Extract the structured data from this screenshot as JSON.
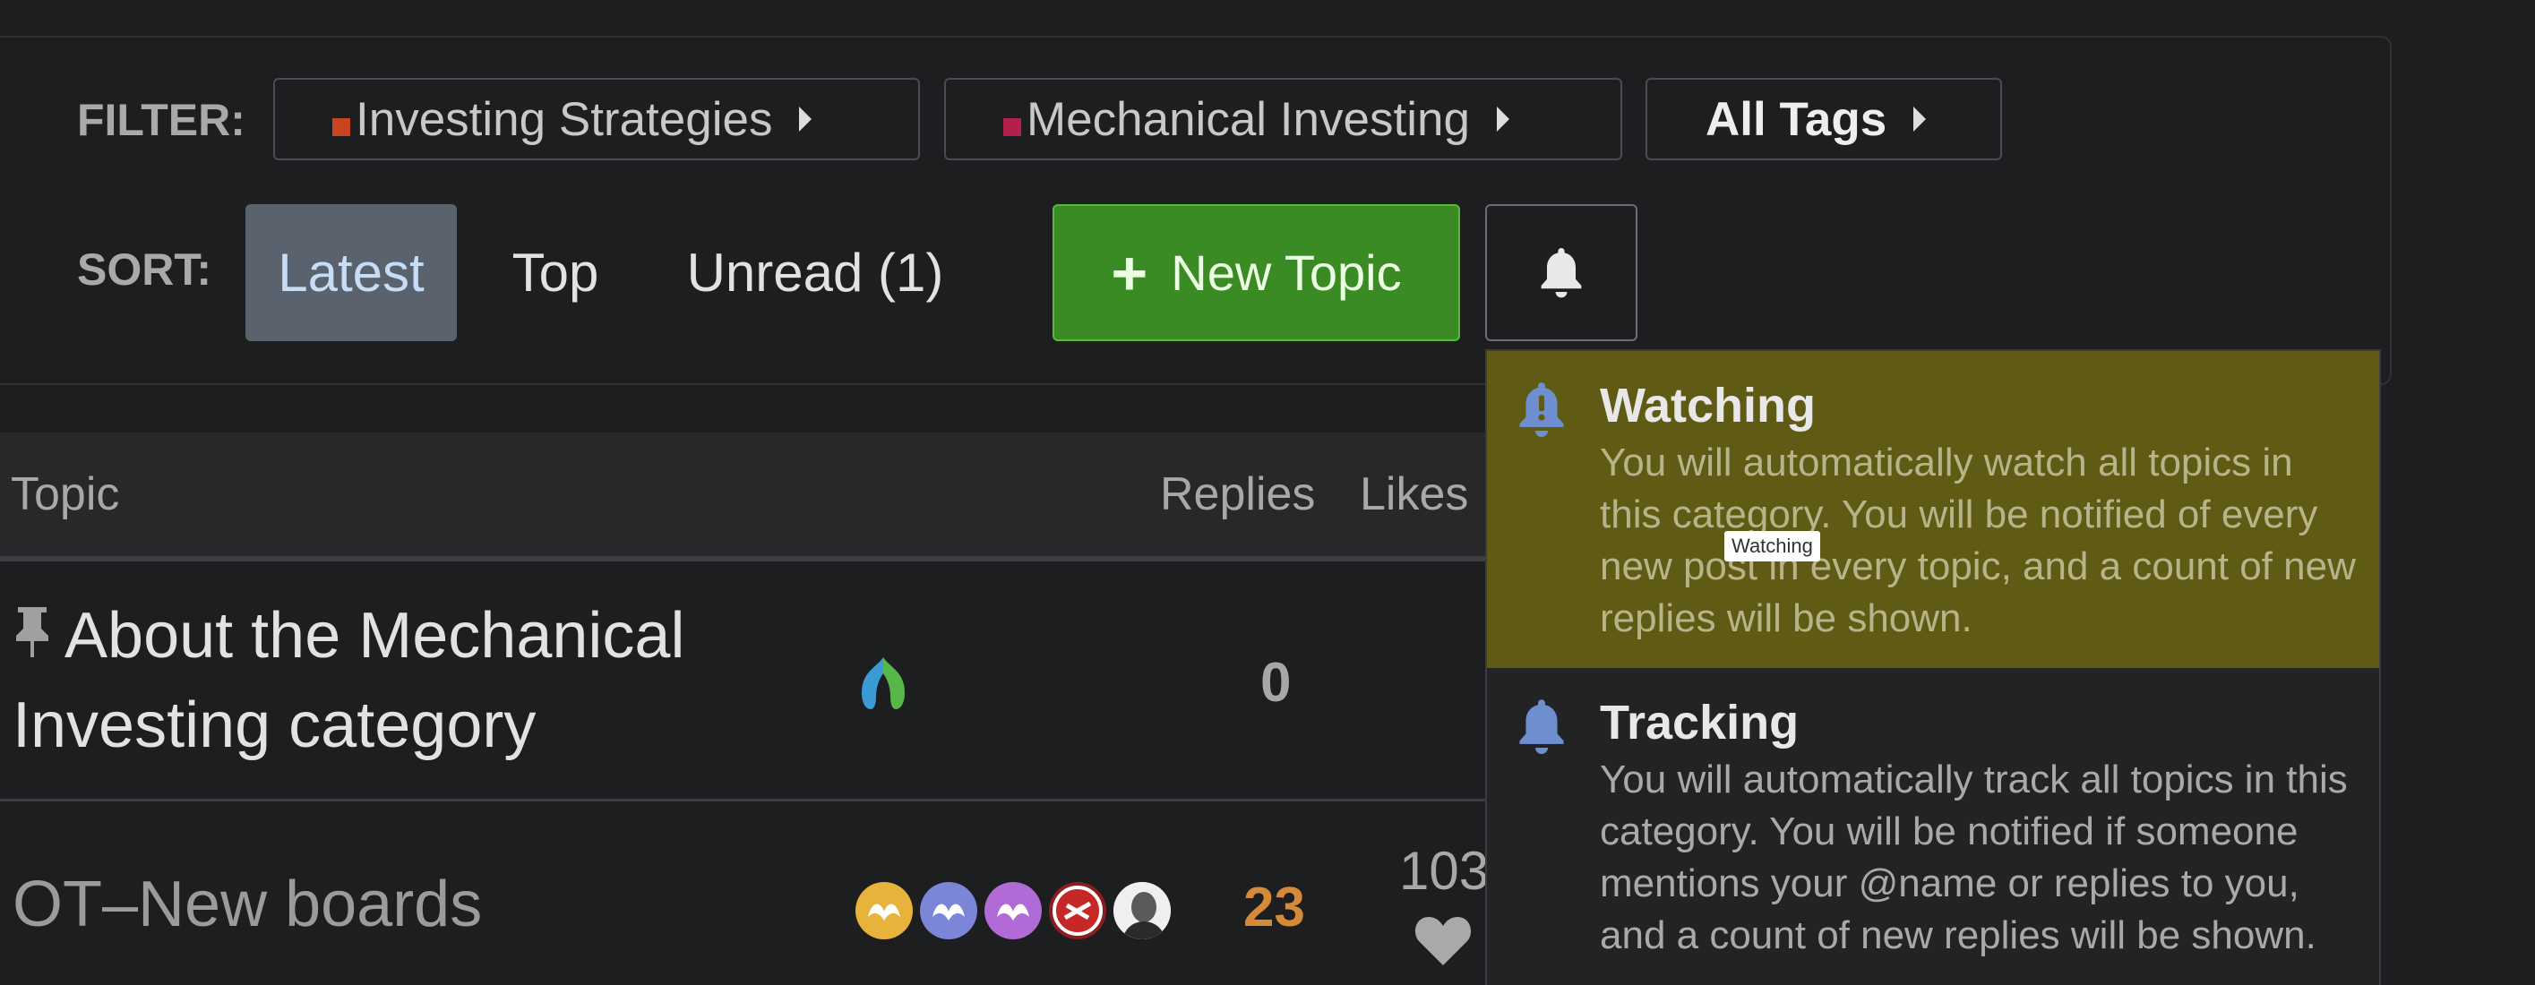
{
  "filter": {
    "label": "FILTER:",
    "categories": [
      {
        "label": "Investing Strategies",
        "color": "#c9451f"
      },
      {
        "label": "Mechanical Investing",
        "color": "#b3204b"
      }
    ],
    "tags_label": "All Tags"
  },
  "sort": {
    "label": "SORT:",
    "items": [
      "Latest",
      "Top",
      "Unread (1)"
    ],
    "active": "Latest"
  },
  "actions": {
    "new_topic_label": "New Topic",
    "notifications_icon": "bell-icon"
  },
  "table": {
    "headers": {
      "topic": "Topic",
      "replies": "Replies",
      "likes": "Likes"
    },
    "rows": [
      {
        "title": "About the Mechanical Investing category",
        "pinned": true,
        "replies": "0"
      },
      {
        "title": "OT–New boards",
        "pinned": false,
        "replies": "23",
        "likes": "103"
      }
    ]
  },
  "notification_menu": {
    "items": [
      {
        "title": "Watching",
        "description": "You will automatically watch all topics in this category. You will be notified of every new post in every topic, and a count of new replies will be shown."
      },
      {
        "title": "Tracking",
        "description": "You will automatically track all topics in this category. You will be notified if someone mentions your @name or replies to you, and a count of new replies will be shown."
      }
    ],
    "tooltip": "Watching"
  },
  "colors": {
    "accent_green": "#3a8b24",
    "active_sort_bg": "#5a636d",
    "watching_highlight": "#5f5a14",
    "reply_hot": "#d58a3a"
  }
}
